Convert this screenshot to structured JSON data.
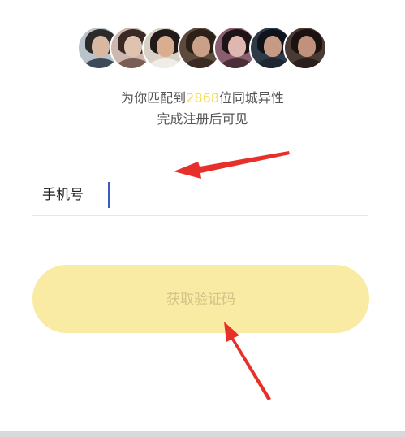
{
  "avatars": [
    {
      "name": "avatar-1",
      "bg": "#b9c3c9",
      "hair": "#2a2a2a",
      "skin": "#d8b8a0",
      "cloth": "#3d4a5a"
    },
    {
      "name": "avatar-2",
      "bg": "#cdb8b0",
      "hair": "#3a2a24",
      "skin": "#e0c2b0",
      "cloth": "#7a5e55"
    },
    {
      "name": "avatar-3",
      "bg": "#d8d2c6",
      "hair": "#201a18",
      "skin": "#d9ad90",
      "cloth": "#f0ece6"
    },
    {
      "name": "avatar-4",
      "bg": "#5c4a3c",
      "hair": "#2c2118",
      "skin": "#caa088",
      "cloth": "#3a2a22"
    },
    {
      "name": "avatar-5",
      "bg": "#8a5d6f",
      "hair": "#1d1416",
      "skin": "#e0b6b0",
      "cloth": "#4b2e3a"
    },
    {
      "name": "avatar-6",
      "bg": "#2e3a48",
      "hair": "#0f141a",
      "skin": "#c79a84",
      "cloth": "#1e2630"
    },
    {
      "name": "avatar-7",
      "bg": "#4a3a34",
      "hair": "#1c1310",
      "skin": "#c2917c",
      "cloth": "#2a1f1b"
    }
  ],
  "match": {
    "prefix": "为你匹配到",
    "count": "2868",
    "suffix": "位同城异性",
    "subtitle": "完成注册后可见"
  },
  "form": {
    "phone_label": "手机号",
    "phone_value": "",
    "phone_placeholder": ""
  },
  "button": {
    "label": "获取验证码"
  },
  "colors": {
    "accent_yellow": "#f3dc5c",
    "button_bg": "#f9eba3",
    "button_text": "#d3c38a",
    "arrow_red": "#e8302a",
    "caret_blue": "#3b5bb8"
  }
}
